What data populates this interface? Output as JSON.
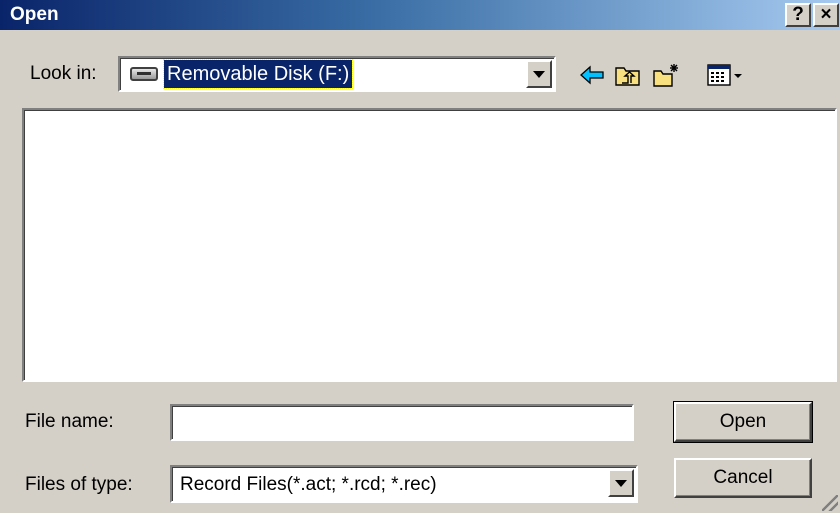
{
  "window": {
    "title": "Open",
    "help_label": "?",
    "close_label": "×"
  },
  "look_in": {
    "label": "Look in:",
    "value": "Removable Disk (F:)",
    "icon": "removable-disk-icon"
  },
  "toolbar": {
    "icons": [
      "back-icon",
      "up-one-level-icon",
      "new-folder-icon",
      "views-menu-icon"
    ]
  },
  "file_list": {
    "items": []
  },
  "file_name": {
    "label": "File name:",
    "value": ""
  },
  "files_of_type": {
    "label": "Files of type:",
    "value": "Record Files(*.act; *.rcd; *.rec)"
  },
  "buttons": {
    "open": "Open",
    "cancel": "Cancel"
  },
  "colors": {
    "titlebar_start": "#0a246a",
    "titlebar_end": "#a6caf0",
    "dialog_face": "#d4d0c8",
    "selection": "#0a246a"
  }
}
